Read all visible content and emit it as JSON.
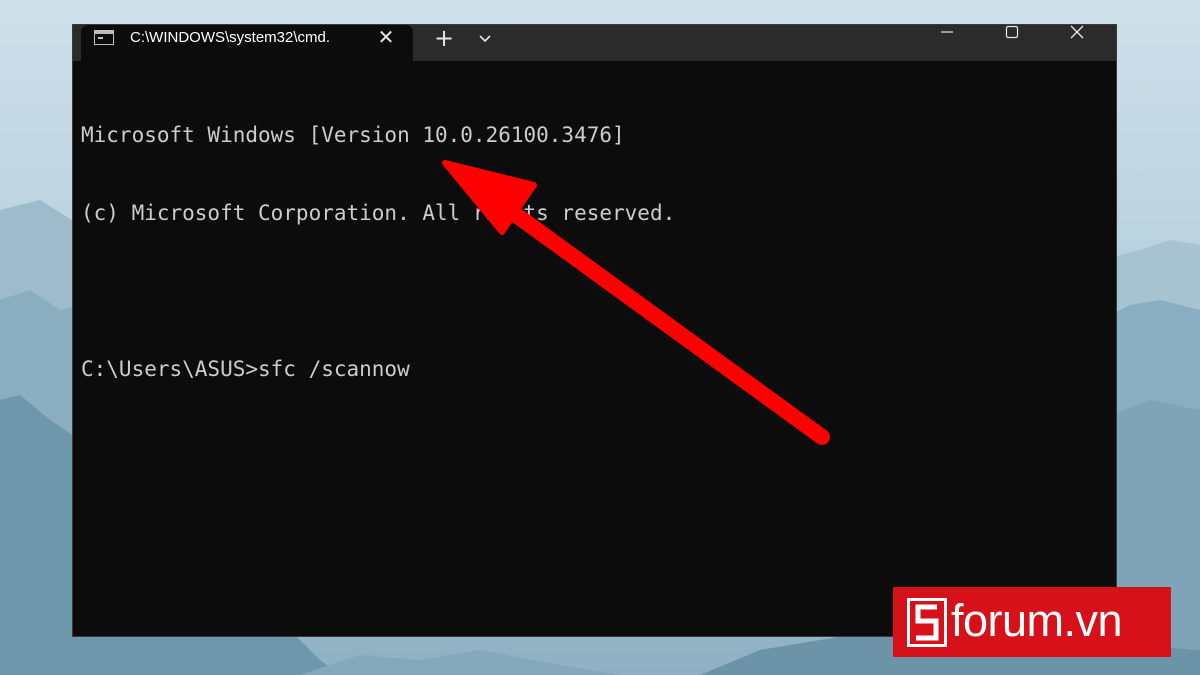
{
  "window": {
    "tab_title": "C:\\WINDOWS\\system32\\cmd.",
    "tab_icon": "console-icon",
    "close_tab_symbol": "✕",
    "new_tab_symbol": "+",
    "dropdown_icon": "chevron-down-icon",
    "controls": [
      "minimize-icon",
      "maximize-icon",
      "close-icon"
    ]
  },
  "terminal": {
    "lines": [
      "Microsoft Windows [Version 10.0.26100.3476]",
      "(c) Microsoft Corporation. All rights reserved.",
      "",
      "C:\\Users\\ASUS>sfc /scannow"
    ]
  },
  "annotation": {
    "icon": "red-arrow-icon",
    "color": "#ff0000"
  },
  "logo": {
    "text": "forum.vn",
    "mark_letter": "S",
    "background": "#d7111a"
  },
  "colors": {
    "terminal_bg": "#0c0c0c",
    "titlebar_bg": "#2b2b2b",
    "terminal_text": "#cccccc"
  }
}
